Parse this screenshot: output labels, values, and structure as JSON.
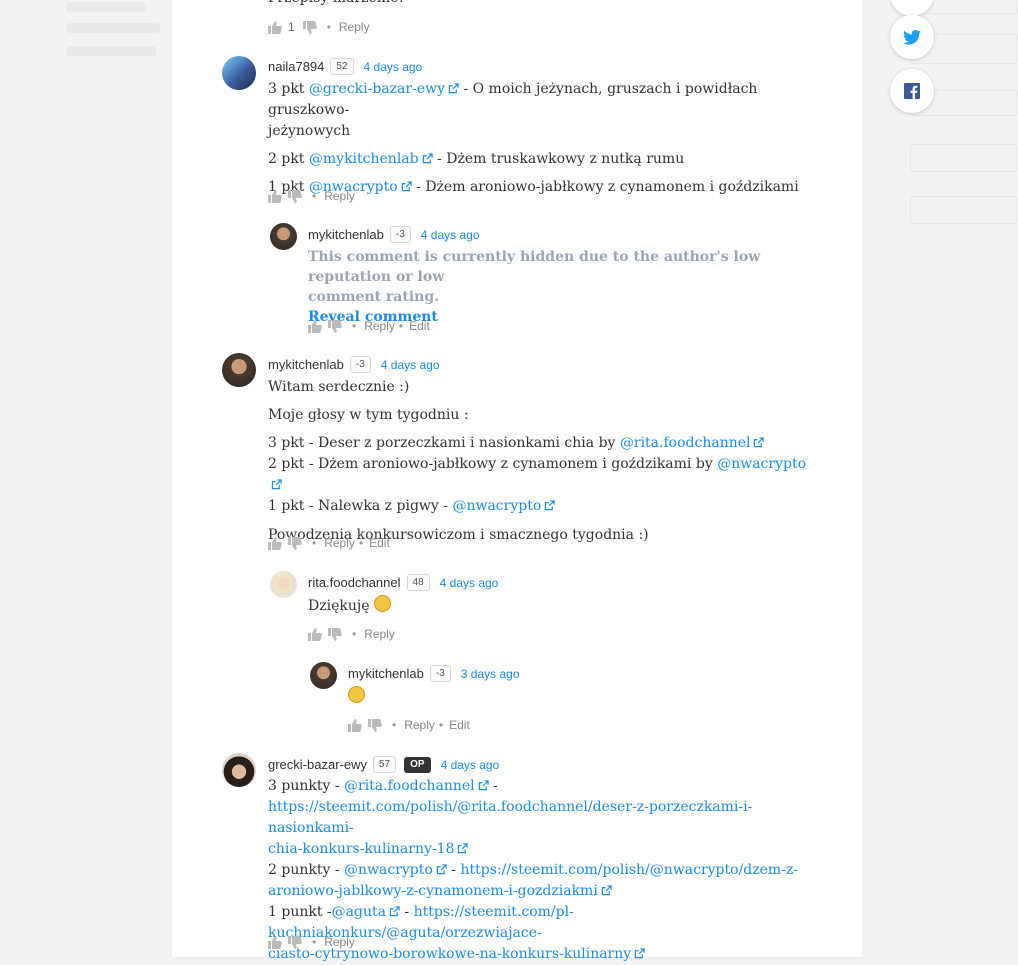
{
  "comments": [
    {
      "body_text": "Przepisy marzenie!",
      "upvotes": "1",
      "reply": "Reply"
    },
    {
      "author": "naila7894",
      "rep": "52",
      "time": "4 days ago",
      "lines": [
        {
          "pre": "3 pkt ",
          "link": "@grecki-bazar-ewy",
          "post": " - O moich jeżynach, gruszach i powidłach gruszkowo-",
          "post2": "jeżynowych"
        },
        {
          "pre": "2 pkt ",
          "link": "@mykitchenlab",
          "post": " - Dżem truskawkowy z nutką rumu"
        },
        {
          "pre": "1 pkt ",
          "link": "@nwacrypto",
          "post": " - Dżem aroniowo-jabłkowy z cynamonem i goździkami"
        }
      ],
      "reply": "Reply"
    },
    {
      "author": "mykitchenlab",
      "rep": "-3",
      "time": "4 days ago",
      "hidden_line1": "This comment is currently hidden due to the author's low reputation or low",
      "hidden_line2": "comment rating.",
      "reveal": "Reveal comment",
      "reply": "Reply",
      "edit": "Edit"
    },
    {
      "author": "mykitchenlab",
      "rep": "-3",
      "time": "4 days ago",
      "greeting": "Witam serdecznie :)",
      "intro": "Moje głosy w tym tygodniu :",
      "votes": [
        {
          "pre": "3 pkt - Deser z porzeczkami i nasionkami chia by ",
          "link": "@rita.foodchannel"
        },
        {
          "pre": "2 pkt - Dżem aroniowo-jabłkowy z cynamonem i goździkami by ",
          "link": "@nwacrypto"
        },
        {
          "pre": "1 pkt - Nalewka z pigwy - ",
          "link": "@nwacrypto"
        }
      ],
      "outro": "Powodzenia konkursowiczom i smacznego tygodnia :)",
      "reply": "Reply",
      "edit": "Edit"
    },
    {
      "author": "rita.foodchannel",
      "rep": "48",
      "time": "4 days ago",
      "body_text": "Dziękuję",
      "emoji": "smiling-face-emoji",
      "reply": "Reply"
    },
    {
      "author": "mykitchenlab",
      "rep": "-3",
      "time": "3 days ago",
      "emoji": "winking-face-emoji",
      "reply": "Reply",
      "edit": "Edit"
    },
    {
      "author": "grecki-bazar-ewy",
      "rep": "57",
      "badge": "OP",
      "time": "4 days ago",
      "l1_pre": "3 punkty - ",
      "l1_link": "@rita.foodchannel",
      "l1_post": " -",
      "l2": "https://steemit.com/polish/@rita.foodchannel/deser-z-porzeczkami-i-nasionkami-",
      "l3": "chia-konkurs-kulinarny-18",
      "l4_pre": "2 punkty - ",
      "l4_link": "@nwacrypto",
      "l4_mid": " - ",
      "l4_url": "https://steemit.com/polish/@nwacrypto/dzem-z-",
      "l5": "aroniowo-jablkowy-z-cynamonem-i-gozdziakmi",
      "l6_pre": "1 punkt -",
      "l6_link": "@aguta",
      "l6_mid": " - ",
      "l6_url": "https://steemit.com/pl-kuchniakonkurs/@aguta/orzezwiajace-",
      "l7": "ciasto-cytrynowo-borowkowe-na-konkurs-kulinarny",
      "reply": "Reply"
    }
  ],
  "share": {
    "twitter": "twitter-icon",
    "facebook": "facebook-icon"
  },
  "colors": {
    "link": "#1a8be6",
    "hidden": "#9aa6b4",
    "badge": "#333333"
  }
}
